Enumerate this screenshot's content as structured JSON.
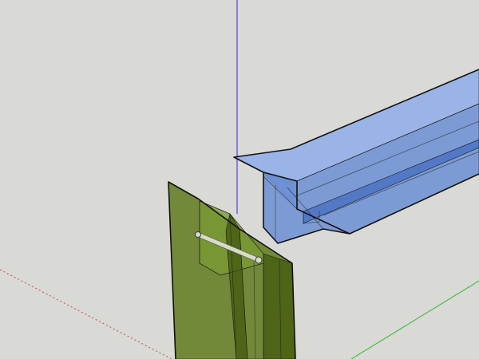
{
  "viewport": {
    "background": "#d9d9d5",
    "axes": {
      "blue_axis_color": "#2b2bd6",
      "green_axis_color": "#33b833",
      "red_axis_color": "#c84a4a"
    }
  },
  "models": {
    "beam": {
      "fill": "#6b8fd4",
      "fill_light": "#8fadea",
      "fill_dark": "#4f76c4",
      "edge": "#1a1a1a"
    },
    "bracket": {
      "fill": "#5f7a1f",
      "fill_light": "#7a9a33",
      "fill_dark": "#4a6114",
      "edge": "#1a1a1a"
    },
    "pin": {
      "fill": "#d7dcc8",
      "edge": "#3a3a3a"
    }
  }
}
